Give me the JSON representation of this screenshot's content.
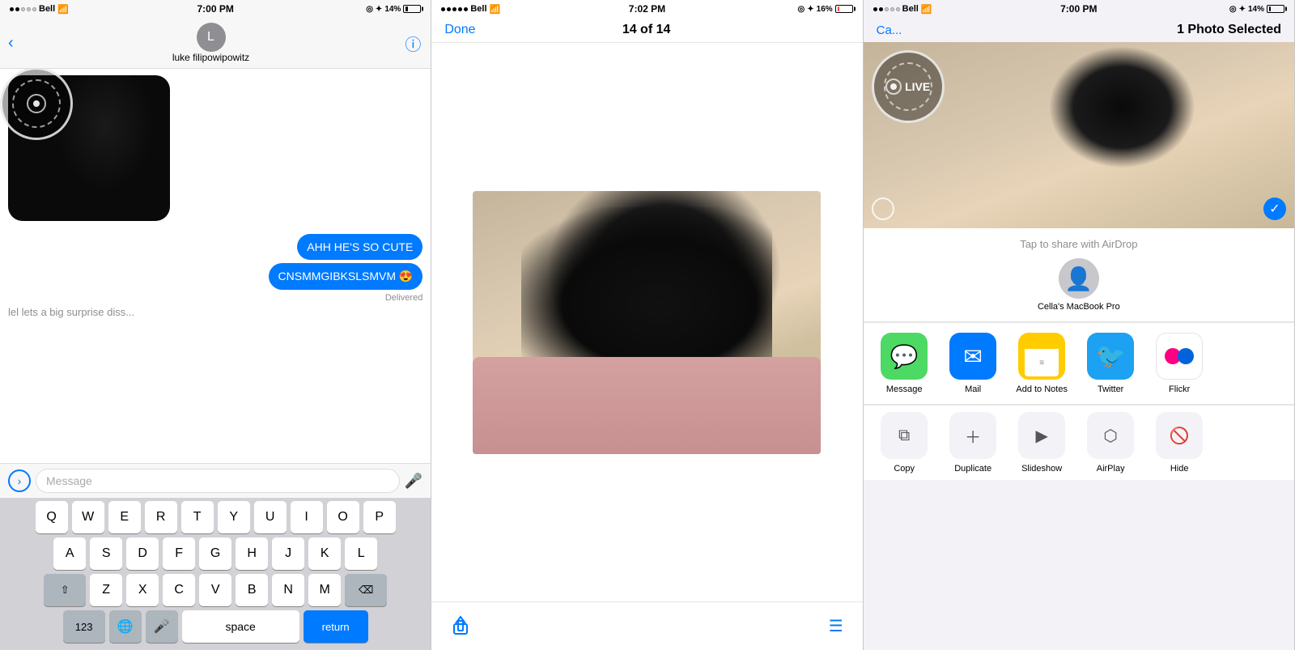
{
  "panel1": {
    "status": {
      "carrier": "Bell",
      "time": "7:00 PM",
      "battery": "14%"
    },
    "contact": "luke filipowipowitz",
    "avatar_letter": "L",
    "messages": [
      {
        "type": "outgoing",
        "text": "AHH HE'S SO CUTE"
      },
      {
        "type": "outgoing",
        "text": "CNSMMGIBKSLSMVM 😍"
      }
    ],
    "delivered": "Delivered",
    "preview_text": "lel lets a big surprise diss...",
    "input_placeholder": "Message",
    "keyboard": {
      "row1": [
        "Q",
        "W",
        "E",
        "R",
        "T",
        "Y",
        "U",
        "I",
        "O",
        "P"
      ],
      "row2": [
        "A",
        "S",
        "D",
        "F",
        "G",
        "H",
        "J",
        "K",
        "L"
      ],
      "row3": [
        "Z",
        "X",
        "C",
        "V",
        "B",
        "N",
        "M"
      ],
      "bottom": [
        "123",
        "🌐",
        "🎤",
        "space",
        "return"
      ]
    }
  },
  "panel2": {
    "status": {
      "carrier": "Bell",
      "time": "7:02 PM",
      "battery": "16%"
    },
    "done_label": "Done",
    "count": "14 of 14",
    "toolbar_share_icon": "↑",
    "toolbar_list_icon": "≡"
  },
  "panel3": {
    "status": {
      "carrier": "Bell",
      "time": "7:00 PM",
      "battery": "14%"
    },
    "cancel_label": "Ca...",
    "title": "1 Photo Selected",
    "airdrop_label": "Tap to share with AirDrop",
    "airdrop_device": "Cella's\nMacBook Pro",
    "share_apps": [
      {
        "label": "Message",
        "icon": "💬",
        "style": "green"
      },
      {
        "label": "Mail",
        "icon": "✉️",
        "style": "blue"
      },
      {
        "label": "Add to Notes",
        "icon": "📝",
        "style": "yellow"
      },
      {
        "label": "Twitter",
        "icon": "🐦",
        "style": "twitter"
      },
      {
        "label": "Flickr",
        "icon": "flickr",
        "style": "flickr"
      }
    ],
    "actions": [
      {
        "label": "Copy",
        "icon": "⧉"
      },
      {
        "label": "Duplicate",
        "icon": "+"
      },
      {
        "label": "Slideshow",
        "icon": "▶"
      },
      {
        "label": "AirPlay",
        "icon": "⬡"
      },
      {
        "label": "Hide",
        "icon": "🚫"
      }
    ]
  }
}
